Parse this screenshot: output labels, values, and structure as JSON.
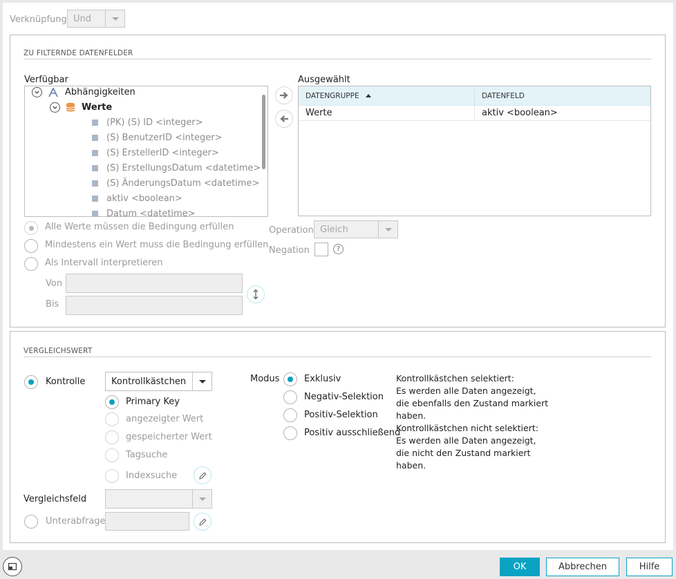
{
  "top": {
    "verknuepfung_label": "Verknüpfung",
    "verknuepfung_value": "Und"
  },
  "fields_section": {
    "title": "ZU FILTERNDE DATENFELDER",
    "available_label": "Verfügbar",
    "selected_label": "Ausgewählt",
    "tree": {
      "root": "Abhängigkeiten",
      "child": "Werte",
      "fields": [
        "(PK) (S) ID <integer>",
        "(S) BenutzerID <integer>",
        "(S) ErstellerID <integer>",
        "(S) ErstellungsDatum <datetime>",
        "(S) ÄnderungsDatum <datetime>",
        "aktiv <boolean>",
        "Datum <datetime>"
      ]
    },
    "table": {
      "col1": "DATENGRUPPE",
      "col2": "DATENFELD",
      "rows": [
        {
          "gruppe": "Werte",
          "feld": "aktiv <boolean>"
        }
      ]
    },
    "conditions": [
      "Alle Werte müssen die Bedingung erfüllen",
      "Mindestens ein Wert muss die Bedingung erfüllen",
      "Als Intervall interpretieren"
    ],
    "von_label": "Von",
    "bis_label": "Bis",
    "operation_label": "Operation",
    "operation_value": "Gleich",
    "negation_label": "Negation"
  },
  "compare_section": {
    "title": "VERGLEICHSWERT",
    "kontrolle_label": "Kontrolle",
    "kontrolle_value": "Kontrollkästchen",
    "options": [
      "Primary Key",
      "angezeigter Wert",
      "gespeicherter Wert",
      "Tagsuche",
      "Indexsuche"
    ],
    "vergleichsfeld_label": "Vergleichsfeld",
    "unterabfrage_label": "Unterabfrage",
    "modus_label": "Modus",
    "modus_options": [
      "Exklusiv",
      "Negativ-Selektion",
      "Positiv-Selektion",
      "Positiv ausschließend"
    ],
    "help_lines": [
      "Kontrollkästchen selektiert:",
      "Es werden alle Daten angezeigt,",
      "die ebenfalls den Zustand markiert",
      "haben.",
      "Kontrollkästchen nicht selektiert:",
      "Es werden alle Daten angezeigt,",
      "die nicht den Zustand markiert",
      "haben."
    ]
  },
  "footer": {
    "ok": "OK",
    "cancel": "Abbrechen",
    "help": "Hilfe"
  },
  "colors": {
    "accent": "#0aa3c4",
    "table_header": "#e3f3f8"
  }
}
